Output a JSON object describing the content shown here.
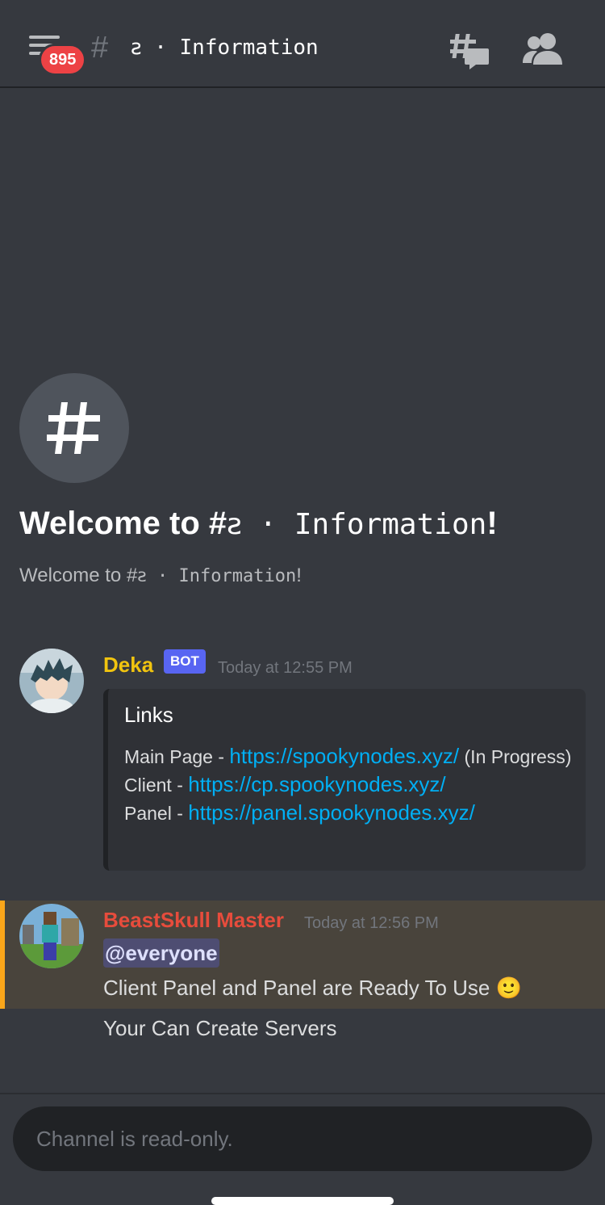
{
  "header": {
    "unread_badge": "895",
    "hash": "#",
    "channel_name": "ꙅ · Information",
    "icons": [
      "hamburger-menu-icon",
      "threads-icon",
      "members-icon"
    ]
  },
  "welcome": {
    "title_prefix": "Welcome to #",
    "title_channel": "ꙅ · Information",
    "title_suffix": "!",
    "subtitle_prefix": "Welcome to #",
    "subtitle_channel": "ꙅ · Information",
    "subtitle_suffix": "!"
  },
  "messages": [
    {
      "author": "Deka",
      "author_color": "#f1c40f",
      "tag": "BOT",
      "timestamp": "Today at 12:55 PM",
      "embed": {
        "title": "Links",
        "rows": [
          {
            "label": "Main Page - ",
            "url": "https://spookynodes.xyz/",
            "suffix": " (In Progress)"
          },
          {
            "label": "Client - ",
            "url": "https://cp.spookynodes.xyz/",
            "suffix": ""
          },
          {
            "label": "Panel - ",
            "url": "https://panel.spookynodes.xyz/",
            "suffix": ""
          }
        ]
      }
    },
    {
      "author": "BeastSkull Master",
      "author_color": "#e74c3c",
      "timestamp": "Today at 12:56 PM",
      "mention": "@everyone",
      "lines": [
        "Client Panel and Panel are Ready To Use",
        "Your Can Create Servers"
      ],
      "emoji": "🙂"
    }
  ],
  "input": {
    "placeholder": "Channel is read-only."
  },
  "colors": {
    "background": "#36393f",
    "accent": "#5865f2",
    "link": "#00aff4",
    "mention_highlight_border": "#faa61a",
    "badge": "#ed4245"
  }
}
